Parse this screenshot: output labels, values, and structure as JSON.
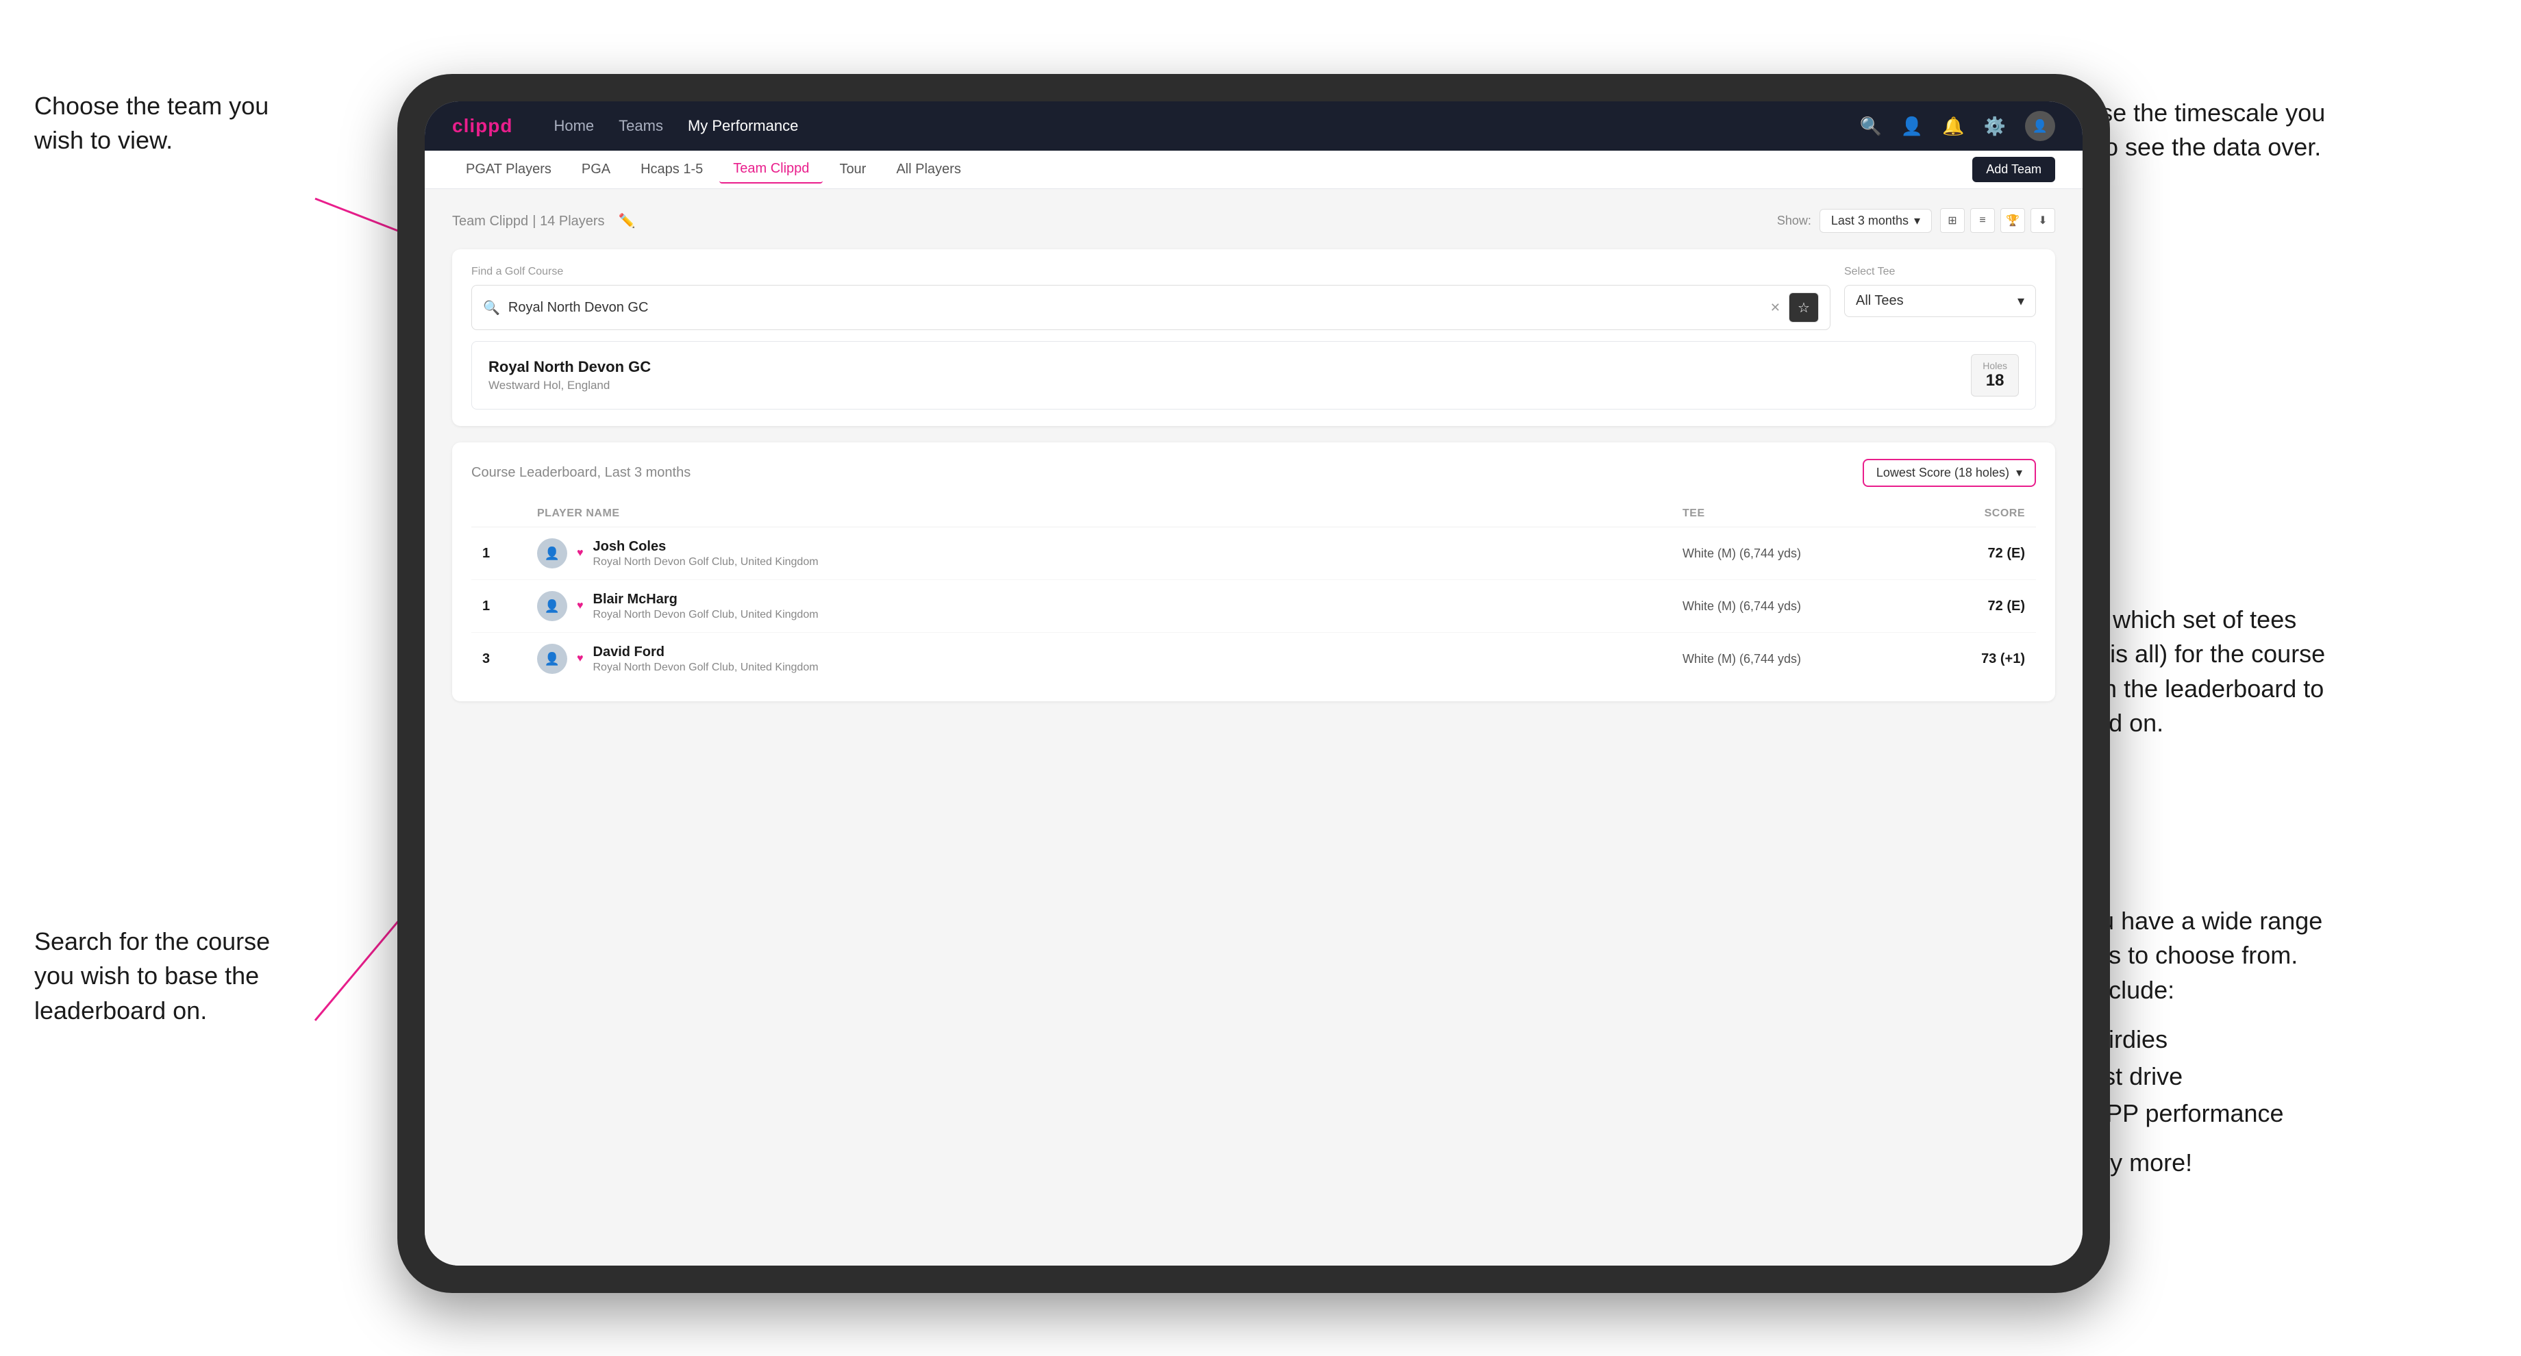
{
  "annotations": {
    "top_left": {
      "line1": "Choose the team you",
      "line2": "wish to view."
    },
    "bottom_left": {
      "line1": "Search for the course",
      "line2": "you wish to base the",
      "line3": "leaderboard on."
    },
    "top_right": {
      "line1": "Choose the timescale you",
      "line2": "wish to see the data over."
    },
    "middle_right": {
      "line1": "Choose which set of tees",
      "line2": "(default is all) for the course",
      "line3": "you wish the leaderboard to",
      "line4": "be based on."
    },
    "bottom_right": {
      "intro": "Here you have a wide range",
      "line2": "of options to choose from.",
      "line3": "These include:",
      "bullets": [
        "Most birdies",
        "Longest drive",
        "Best APP performance"
      ],
      "suffix": "and many more!"
    }
  },
  "nav": {
    "logo": "clippd",
    "links": [
      "Home",
      "Teams",
      "My Performance"
    ],
    "active_link": "My Performance",
    "icons": [
      "🔍",
      "👤",
      "🔔",
      "⚙️"
    ]
  },
  "sub_nav": {
    "items": [
      "PGAT Players",
      "PGA",
      "Hcaps 1-5",
      "Team Clippd",
      "Tour",
      "All Players"
    ],
    "active": "Team Clippd",
    "add_team_label": "Add Team"
  },
  "team_header": {
    "title": "Team Clippd",
    "count": "14 Players",
    "show_label": "Show:",
    "period": "Last 3 months"
  },
  "search_section": {
    "find_label": "Find a Golf Course",
    "placeholder": "Royal North Devon GC",
    "tee_label": "Select Tee",
    "tee_value": "All Tees"
  },
  "course_result": {
    "name": "Royal North Devon GC",
    "location": "Westward Hol, England",
    "holes_label": "Holes",
    "holes_value": "18"
  },
  "leaderboard": {
    "title": "Course Leaderboard,",
    "period": "Last 3 months",
    "score_filter": "Lowest Score (18 holes)",
    "columns": {
      "player": "PLAYER NAME",
      "tee": "TEE",
      "score": "SCORE"
    },
    "rows": [
      {
        "rank": "1",
        "name": "Josh Coles",
        "club": "Royal North Devon Golf Club, United Kingdom",
        "tee": "White (M) (6,744 yds)",
        "score": "72 (E)"
      },
      {
        "rank": "1",
        "name": "Blair McHarg",
        "club": "Royal North Devon Golf Club, United Kingdom",
        "tee": "White (M) (6,744 yds)",
        "score": "72 (E)"
      },
      {
        "rank": "3",
        "name": "David Ford",
        "club": "Royal North Devon Golf Club, United Kingdom",
        "tee": "White (M) (6,744 yds)",
        "score": "73 (+1)"
      }
    ]
  }
}
